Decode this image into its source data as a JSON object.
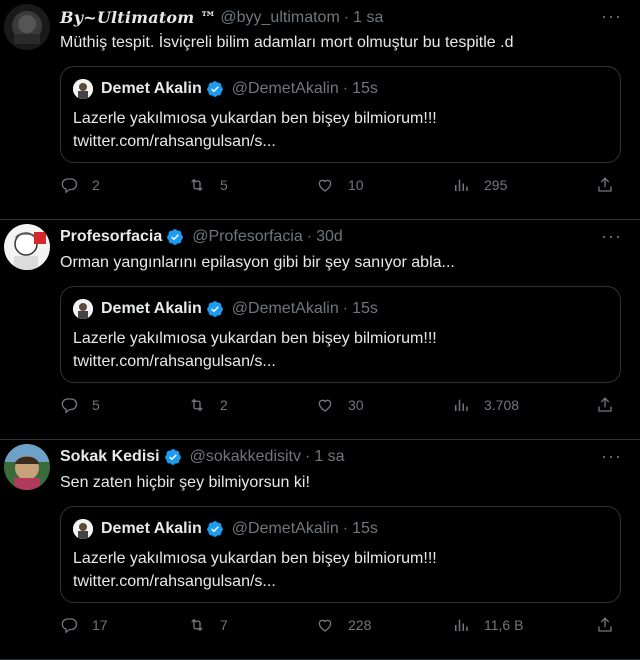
{
  "tweets": [
    {
      "name": "By~Ultimatom ™",
      "handle": "@byy_ultimatom",
      "sep": "·",
      "time": "1 sa",
      "text": "Müthiş tespit. İsviçreli bilim adamları mort olmuştur bu tespitle .d",
      "verified": false,
      "quote": {
        "name": "Demet Akalin",
        "handle": "@DemetAkalin",
        "sep": "·",
        "time": "15s",
        "line1": "Lazerle yakılmıosa yukardan ben bişey bilmiorum!!!",
        "line2": "twitter.com/rahsangulsan/s..."
      },
      "replies": "2",
      "retweets": "5",
      "likes": "10",
      "views": "295"
    },
    {
      "name": "Profesorfacia",
      "handle": "@Profesorfacia",
      "sep": "·",
      "time": "30d",
      "text": "Orman yangınlarını epilasyon gibi bir şey sanıyor abla...",
      "verified": true,
      "quote": {
        "name": "Demet Akalin",
        "handle": "@DemetAkalin",
        "sep": "·",
        "time": "15s",
        "line1": "Lazerle yakılmıosa yukardan ben bişey bilmiorum!!!",
        "line2": "twitter.com/rahsangulsan/s..."
      },
      "replies": "5",
      "retweets": "2",
      "likes": "30",
      "views": "3.708"
    },
    {
      "name": "Sokak Kedisi",
      "handle": "@sokakkedisitv",
      "sep": "·",
      "time": "1 sa",
      "text": "Sen zaten hiçbir şey bilmiyorsun ki!",
      "verified": true,
      "quote": {
        "name": "Demet Akalin",
        "handle": "@DemetAkalin",
        "sep": "·",
        "time": "15s",
        "line1": "Lazerle yakılmıosa yukardan ben bişey bilmiorum!!!",
        "line2": "twitter.com/rahsangulsan/s..."
      },
      "replies": "17",
      "retweets": "7",
      "likes": "228",
      "views": "11,6 B"
    }
  ],
  "more_label": "···",
  "colors": {
    "background": "#000000",
    "text": "#e7e9ea",
    "muted": "#71767b",
    "border": "#2f3336",
    "verified": "#1d9bf0"
  },
  "icons": {
    "reply": "reply-icon",
    "retweet": "retweet-icon",
    "like": "heart-icon",
    "views": "views-icon",
    "share": "share-icon",
    "verified": "verified-badge-icon"
  }
}
